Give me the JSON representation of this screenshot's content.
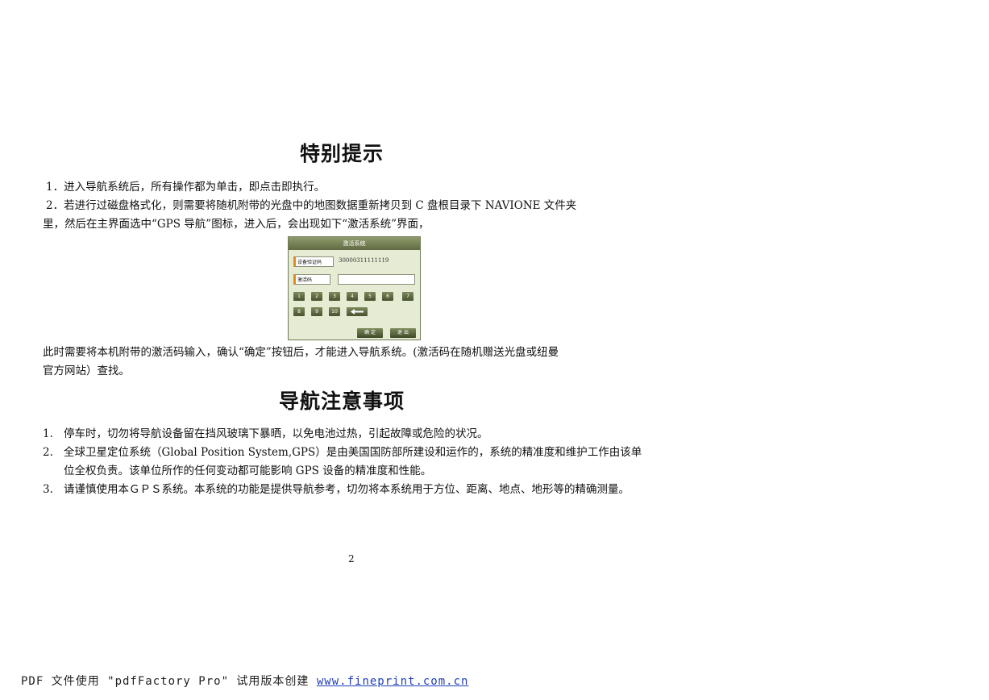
{
  "section1": {
    "title": "特别提示",
    "item1": "1．进入导航系统后，所有操作都为单击，即点击即执行。",
    "item2_line1": "2．若进行过磁盘格式化，则需要将随机附带的光盘中的地图数据重新拷贝到 C 盘根目录下 NAVIONE 文件夹",
    "item2_line2": "里，然后在主界面选中“GPS 导航”图标，进入后，会出现如下“激活系统”界面，",
    "after_line1": "此时需要将本机附带的激活码输入，确认“确定”按钮后，才能进入导航系统。(激活码在随机赠送光盘或纽曼",
    "after_line2": "官方网站）查找。"
  },
  "dialog": {
    "title": "激活系统",
    "device_code_label": "设备验证码",
    "device_code_value": "30000311111119",
    "activation_label": "激活码",
    "keys": [
      "1",
      "2",
      "3",
      "4",
      "5",
      "6",
      "7",
      "8",
      "9",
      "10"
    ],
    "ok_label": "确 定",
    "exit_label": "退 出"
  },
  "section2": {
    "title": "导航注意事项",
    "items": [
      {
        "num": "1.",
        "text": "停车时，切勿将导航设备留在挡风玻璃下暴晒，以免电池过热，引起故障或危险的状况。"
      },
      {
        "num": "2.",
        "text": "全球卫星定位系统（Global Position System,GPS）是由美国国防部所建设和运作的，系统的精准度和维护工作由该单位全权负责。该单位所作的任何变动都可能影响 GPS 设备的精准度和性能。"
      },
      {
        "num": "3.",
        "text": "请谨慎使用本ＧＰＳ系统。本系统的功能是提供导航参考，切勿将本系统用于方位、距离、地点、地形等的精确测量。"
      }
    ]
  },
  "page_number": "2",
  "footer": {
    "text": "PDF 文件使用 \"pdfFactory Pro\" 试用版本创建",
    "link": "www.fineprint.com.cn"
  }
}
